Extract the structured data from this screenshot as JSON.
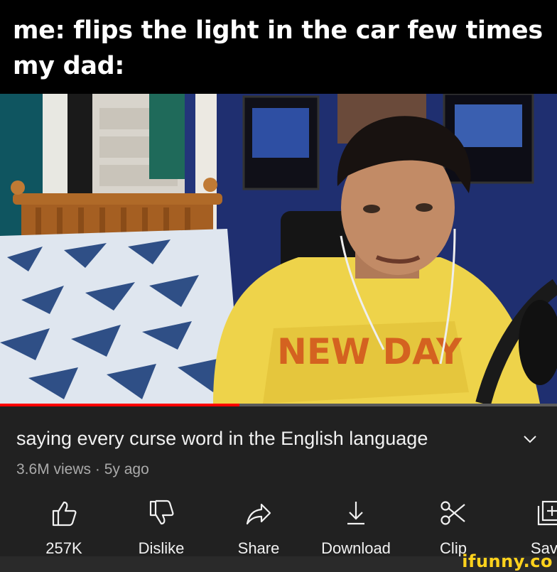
{
  "caption": {
    "line1": "me: flips the light in the car few times",
    "line2": "my dad:"
  },
  "video": {
    "title": "saying every curse word in the English language",
    "views": "3.6M views",
    "age": "5y ago",
    "progress": 0.43
  },
  "actions": [
    {
      "label": "257K",
      "icon": "thumbs-up-icon"
    },
    {
      "label": "Dislike",
      "icon": "thumbs-down-icon"
    },
    {
      "label": "Share",
      "icon": "share-icon"
    },
    {
      "label": "Download",
      "icon": "download-icon"
    },
    {
      "label": "Clip",
      "icon": "scissors-icon"
    },
    {
      "label": "Save",
      "icon": "save-playlist-icon"
    }
  ],
  "watermark": "ifunny.co",
  "colors": {
    "panel": "#212121",
    "progress": "#ff0000",
    "watermark": "#ffd21c"
  }
}
